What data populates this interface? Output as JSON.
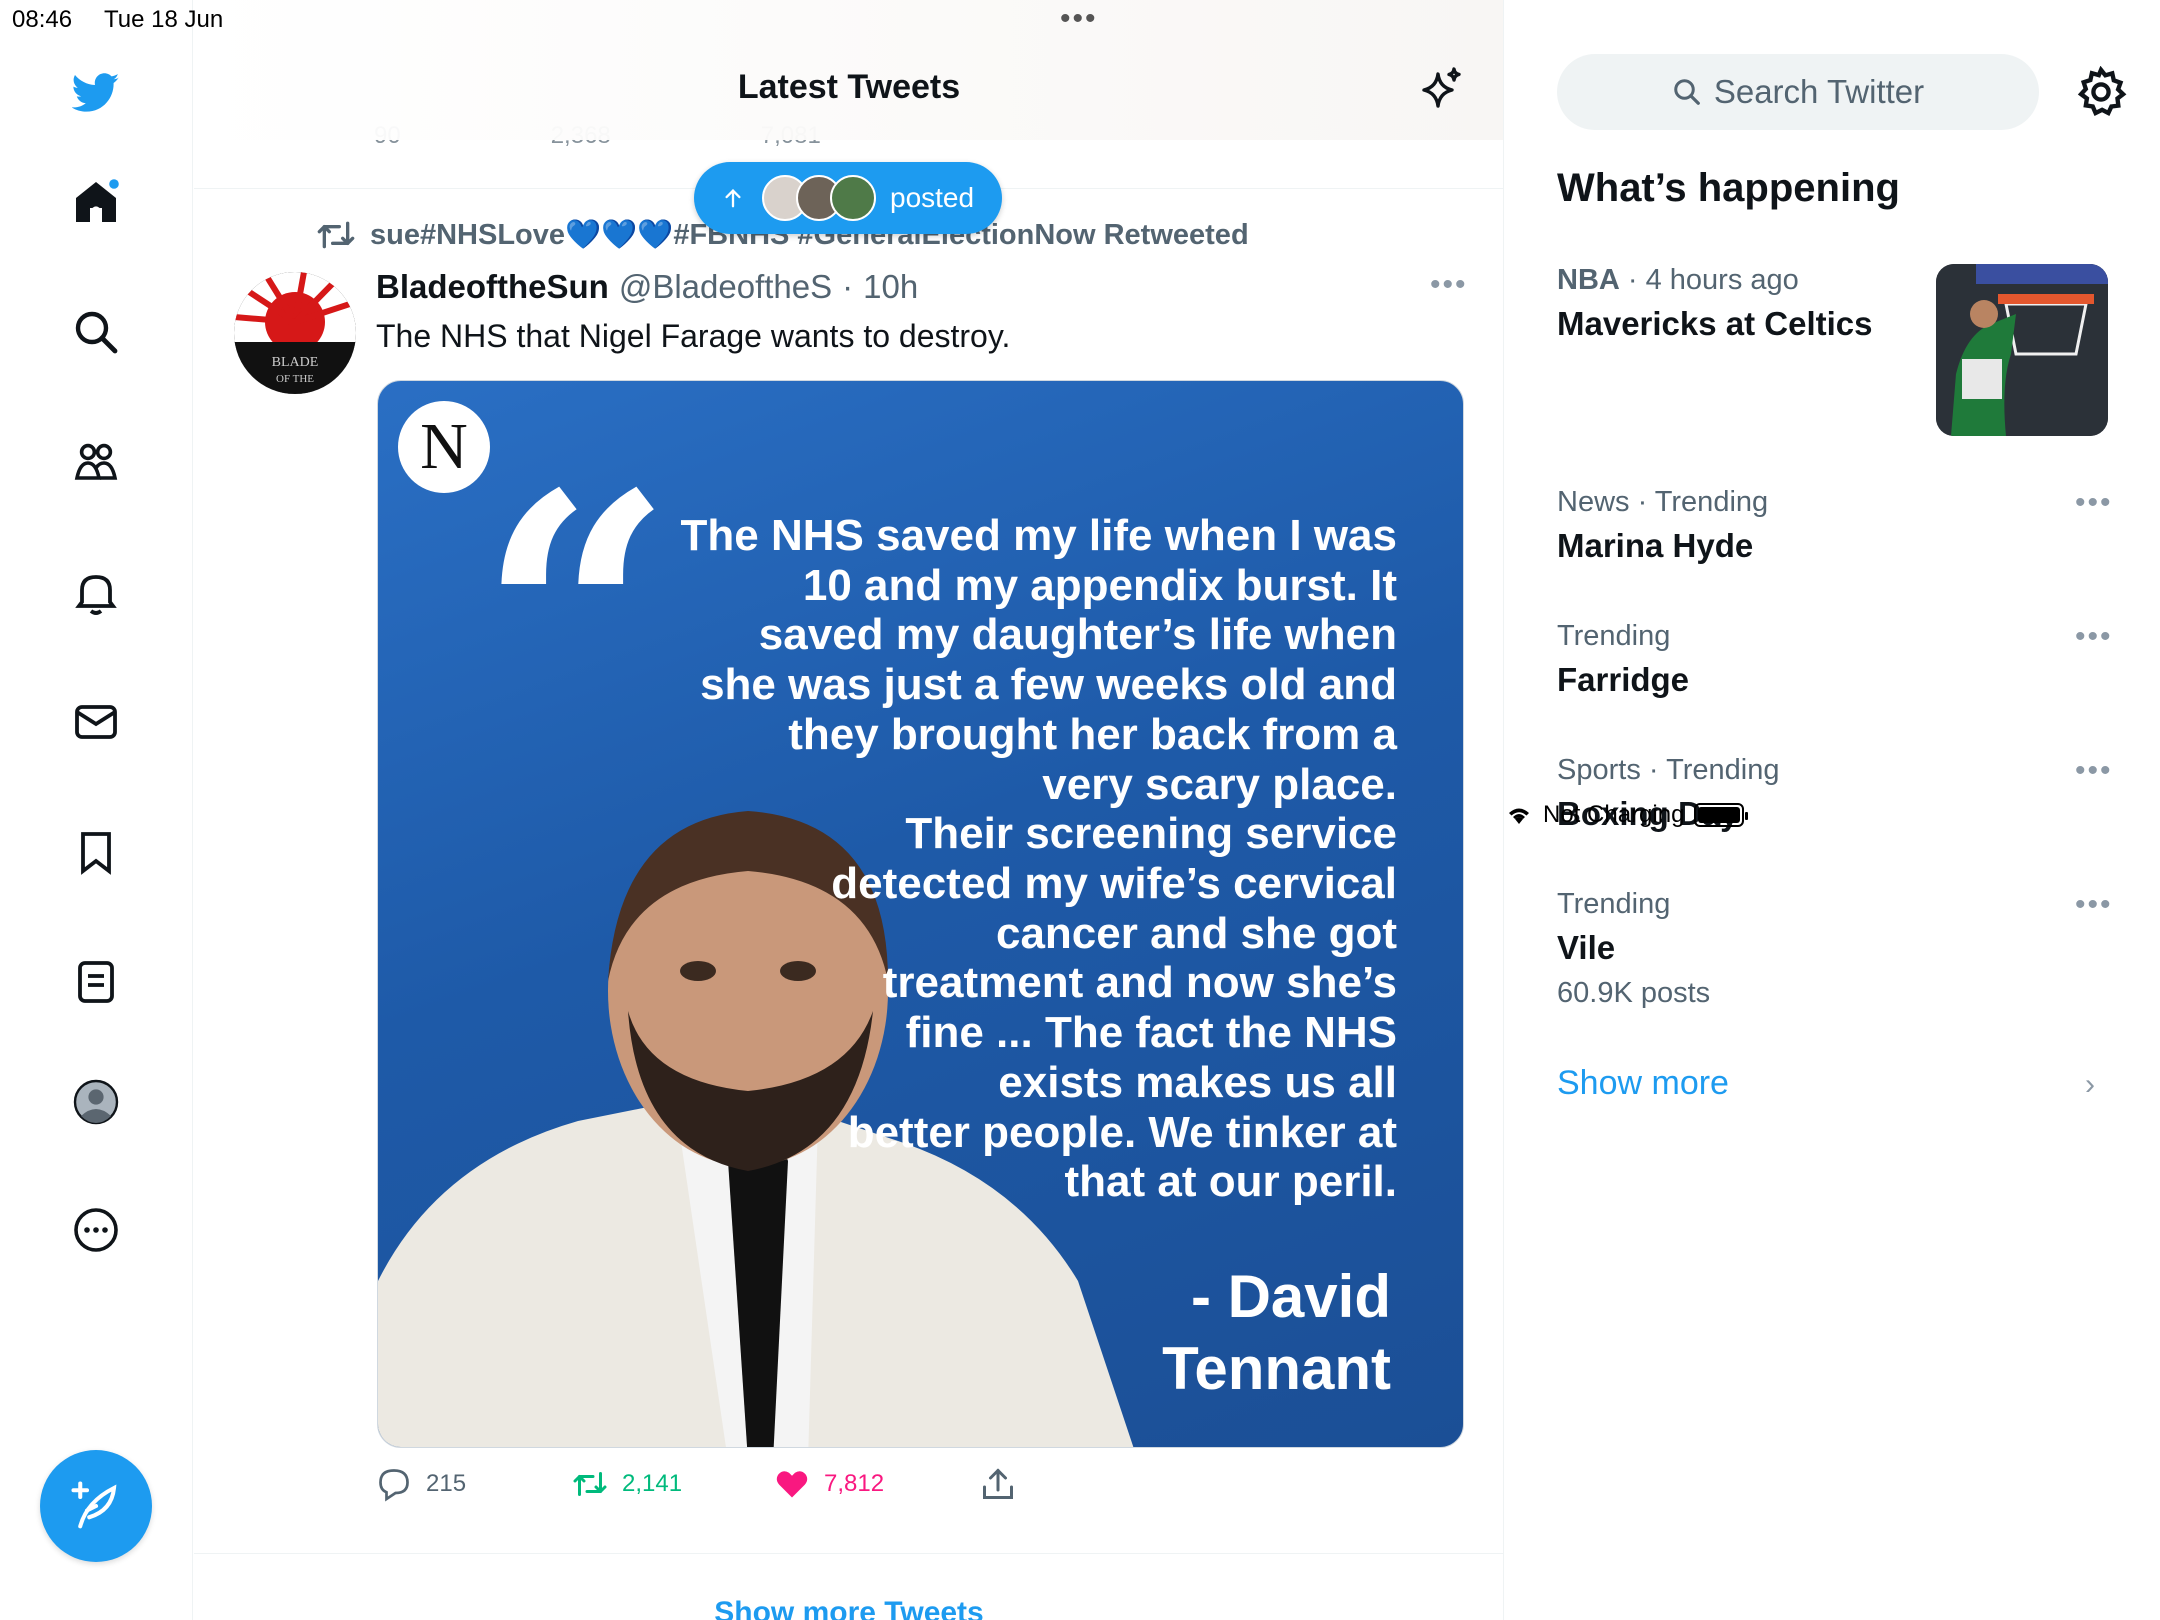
{
  "status_bar": {
    "time": "08:46",
    "date": "Tue 18 Jun",
    "multitask_dots": "•••",
    "charging": "Not Charging"
  },
  "nav": {
    "items": [
      "twitter-logo",
      "home",
      "explore",
      "communities",
      "notifications",
      "messages",
      "bookmarks",
      "lists",
      "profile",
      "more"
    ],
    "compose_icon": "compose-feather"
  },
  "header": {
    "title": "Latest Tweets",
    "prev_reply_count": "90",
    "prev_retweet_count": "2,368",
    "prev_like_count": "7,081"
  },
  "new_posts_pill": {
    "label": "posted"
  },
  "tweet": {
    "retweeted_by": "sue#NHSLove💙💙💙#FBNHS #GeneralElectionNow Retweeted",
    "display_name": "BladeoftheSun",
    "handle": "@BladeoftheS",
    "separator": "·",
    "time": "10h",
    "more": "•••",
    "text": "The NHS that Nigel Farage wants to destroy.",
    "media": {
      "logo_letter": "N",
      "quote_mark": "“",
      "quote": "The NHS saved my life when I was\n10 and my appendix burst. It\nsaved my daughter’s life when\nshe was just a few weeks old and\nthey brought her back from a\nvery scary place.\nTheir screening service\ndetected my wife’s cervical\ncancer and she got\ntreatment and now she’s\nfine ... The fact the NHS\nexists makes us all\nbetter people. We tinker at\nthat at our peril.",
      "author": "- David\nTennant"
    },
    "reply_count": "215",
    "retweet_count": "2,141",
    "like_count": "7,812",
    "colors": {
      "retweet": "#00ba7c",
      "like": "#f91880",
      "accent": "#1d9bf0"
    }
  },
  "show_more_tweets": "Show more Tweets",
  "sidebar": {
    "search_placeholder": "Search Twitter",
    "whats_happening": "What’s happening",
    "trends": [
      {
        "category": "NBA",
        "meta_rest": " · 4 hours ago",
        "name": "Mavericks at Celtics",
        "count": ""
      },
      {
        "category": "News",
        "meta_rest": " · Trending",
        "name": "Marina Hyde",
        "count": ""
      },
      {
        "category": "Trending",
        "meta_rest": "",
        "name": "Farridge",
        "count": ""
      },
      {
        "category": "Sports",
        "meta_rest": " · Trending",
        "name": "Boxing Day",
        "count": ""
      },
      {
        "category": "Trending",
        "meta_rest": "",
        "name": "Vile",
        "count": "60.9K posts"
      }
    ],
    "trend_more": "•••",
    "show_more": "Show more",
    "chevron": "›"
  }
}
